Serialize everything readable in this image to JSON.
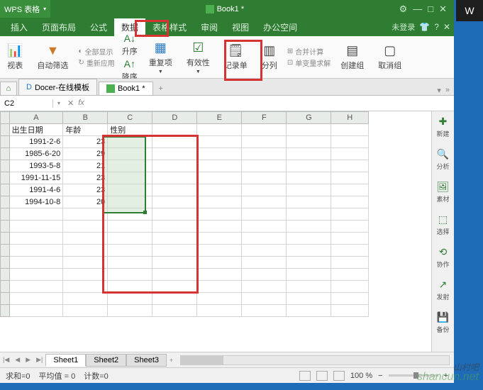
{
  "app": {
    "name": "WPS 表格",
    "doc_title": "Book1 *"
  },
  "win_controls": {
    "settings": "⚙",
    "min": "—",
    "max": "□",
    "close": "✕"
  },
  "menu": {
    "items": [
      "插入",
      "页面布局",
      "公式",
      "数据",
      "表格样式",
      "审阅",
      "视图",
      "办公空间"
    ],
    "active_index": 3,
    "login": "未登录",
    "right_icons": [
      "👕",
      "?",
      "✕"
    ]
  },
  "ribbon": {
    "pivot": "视表",
    "autofilter": "自动筛选",
    "show_all": "全部显示",
    "reapply": "重新应用",
    "sort_asc": "升序",
    "sort_desc": "降序",
    "duplicates": "重复项",
    "validity": "有效性",
    "form": "记录单",
    "text_to_cols": "分列",
    "consolidate": "合并计算",
    "solver": "单变量求解",
    "group": "创建组",
    "ungroup": "取消组"
  },
  "doc_tabs": {
    "docer": "Docer-在线模板",
    "book1": "Book1 *"
  },
  "cell_ref": {
    "name": "C2",
    "fx": "fx"
  },
  "columns": [
    "A",
    "B",
    "C",
    "D",
    "E",
    "F",
    "G",
    "H"
  ],
  "headers": {
    "a": "出生日期",
    "b": "年龄",
    "c": "性别"
  },
  "rows": [
    {
      "a": "1991-2-6",
      "b": "23"
    },
    {
      "a": "1985-6-20",
      "b": "29"
    },
    {
      "a": "1993-5-8",
      "b": "21"
    },
    {
      "a": "1991-11-15",
      "b": "23"
    },
    {
      "a": "1991-4-6",
      "b": "23"
    },
    {
      "a": "1994-10-8",
      "b": "20"
    }
  ],
  "sidebar": {
    "new": "新建",
    "analyze": "分析",
    "material": "素材",
    "select": "选择",
    "collab": "协作",
    "launch": "发射",
    "backup": "备份"
  },
  "sheets": {
    "s1": "Sheet1",
    "s2": "Sheet2",
    "s3": "Sheet3"
  },
  "status": {
    "sum": "求和=0",
    "avg": "平均值 = 0",
    "count": "计数=0",
    "zoom": "100 %"
  },
  "watermark": {
    "url": "shancun.net",
    "cn": "山村吧"
  },
  "right_edge": "W"
}
